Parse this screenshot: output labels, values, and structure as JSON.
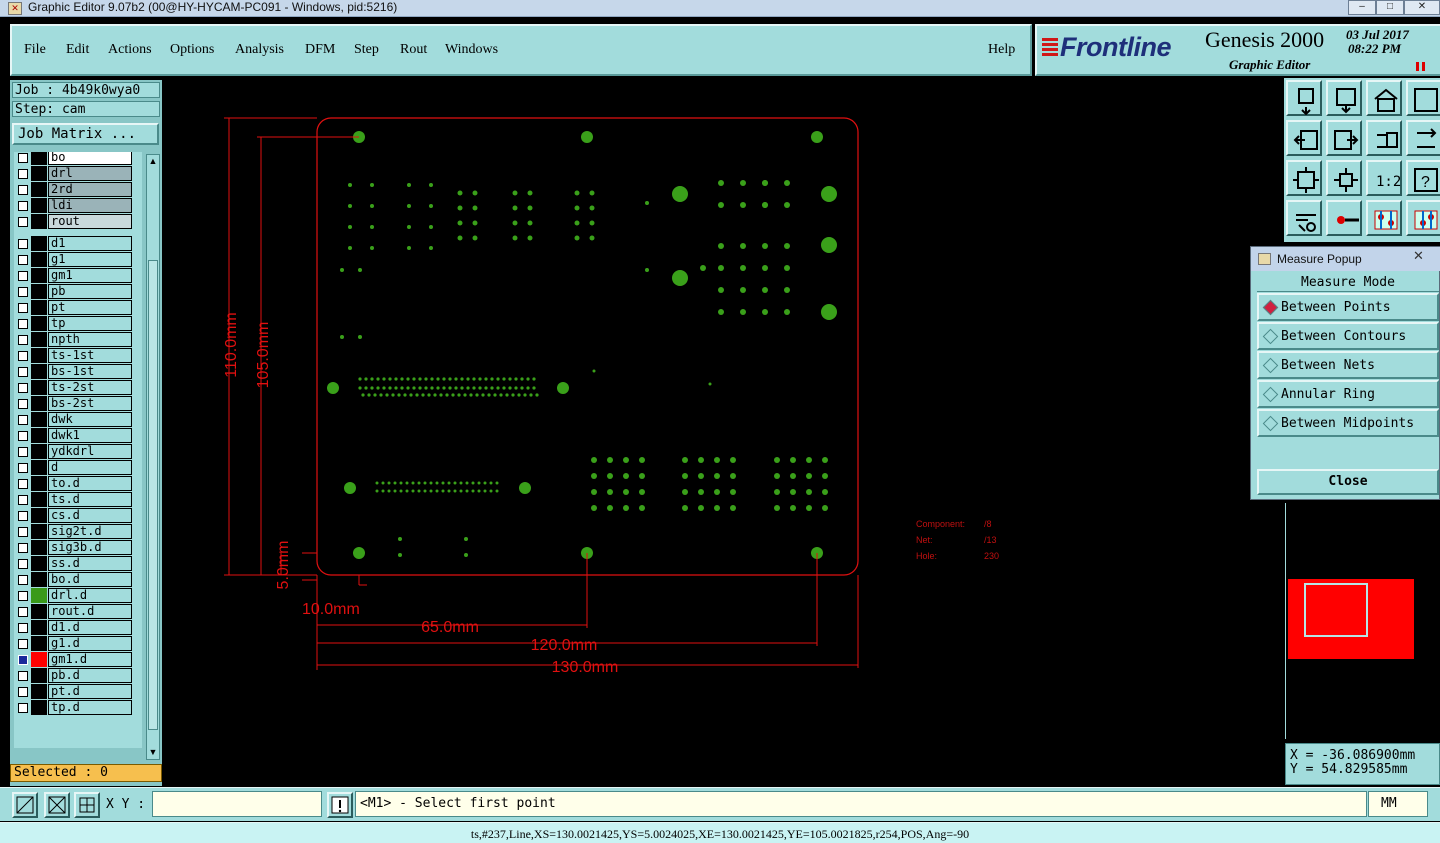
{
  "window": {
    "title": "Graphic Editor 9.07b2 (00@HY-HYCAM-PC091 - Windows, pid:5216)",
    "controls": [
      "–",
      "□",
      "✕"
    ]
  },
  "menu": {
    "items": [
      "File",
      "Edit",
      "Actions",
      "Options",
      "Analysis",
      "DFM",
      "Step",
      "Rout",
      "Windows"
    ],
    "help": "Help"
  },
  "brand": {
    "logo": "Frontline",
    "product": "Genesis 2000",
    "subtitle": "Graphic Editor",
    "date": "03 Jul 2017",
    "time": "08:22 PM"
  },
  "job": {
    "job_line": "Job : 4b49k0wya0",
    "step_line": "Step: cam",
    "matrix_button": "Job Matrix ..."
  },
  "layers": [
    {
      "name": "bo",
      "style": "w"
    },
    {
      "name": "drl",
      "style": "g"
    },
    {
      "name": "2rd",
      "style": "g"
    },
    {
      "name": "ldi",
      "style": "g"
    },
    {
      "name": "rout",
      "style": "lg"
    },
    {
      "name": "d1",
      "style": ""
    },
    {
      "name": "g1",
      "style": ""
    },
    {
      "name": "gm1",
      "style": ""
    },
    {
      "name": "pb",
      "style": ""
    },
    {
      "name": "pt",
      "style": ""
    },
    {
      "name": "tp",
      "style": ""
    },
    {
      "name": "npth",
      "style": ""
    },
    {
      "name": "ts-1st",
      "style": ""
    },
    {
      "name": "bs-1st",
      "style": ""
    },
    {
      "name": "ts-2st",
      "style": ""
    },
    {
      "name": "bs-2st",
      "style": ""
    },
    {
      "name": "dwk",
      "style": ""
    },
    {
      "name": "dwk1",
      "style": ""
    },
    {
      "name": "ydkdrl",
      "style": ""
    },
    {
      "name": "d",
      "style": ""
    },
    {
      "name": "to.d",
      "style": ""
    },
    {
      "name": "ts.d",
      "style": ""
    },
    {
      "name": "cs.d",
      "style": ""
    },
    {
      "name": "sig2t.d",
      "style": ""
    },
    {
      "name": "sig3b.d",
      "style": ""
    },
    {
      "name": "ss.d",
      "style": ""
    },
    {
      "name": "bo.d",
      "style": ""
    },
    {
      "name": "drl.d",
      "style": "",
      "swatch": "#3a9a1a"
    },
    {
      "name": "rout.d",
      "style": ""
    },
    {
      "name": "d1.d",
      "style": ""
    },
    {
      "name": "g1.d",
      "style": ""
    },
    {
      "name": "gm1.d",
      "style": "",
      "swatch": "#ff0000",
      "active": true
    },
    {
      "name": "pb.d",
      "style": ""
    },
    {
      "name": "pt.d",
      "style": ""
    },
    {
      "name": "tp.d",
      "style": ""
    }
  ],
  "selected": "Selected : 0",
  "measure_popup": {
    "title": "Measure Popup",
    "header": "Measure Mode",
    "modes": [
      "Between Points",
      "Between Contours",
      "Between Nets",
      "Annular Ring",
      "Between Midpoints"
    ],
    "active_mode": "Between Points",
    "close": "Close"
  },
  "coords": {
    "x": "X = -36.086900mm",
    "y": "Y = 54.829585mm"
  },
  "bottom": {
    "xy_label": "X Y :",
    "xy_value": "",
    "prompt": "<M1> - Select first point",
    "units": "MM"
  },
  "status": "ts,#237,Line,XS=130.0021425,YS=5.0024025,XE=130.0021425,YE=105.0021825,r254,POS,Ang=-90",
  "drawing": {
    "dimensions": {
      "height_outer": "110.0mm",
      "height_inner": "105.0mm",
      "offset_y": "5.0mm",
      "offset_x": "10.0mm",
      "width_65": "65.0mm",
      "width_120": "120.0mm",
      "width_130": "130.0mm"
    },
    "info": {
      "component_label": "Component:",
      "component_value": "/8",
      "net_label": "Net:",
      "net_value": "/13",
      "hole_label": "Hole:",
      "hole_value": "230"
    },
    "colors": {
      "outline": "#e01010",
      "pads": "#3aa01a"
    }
  }
}
